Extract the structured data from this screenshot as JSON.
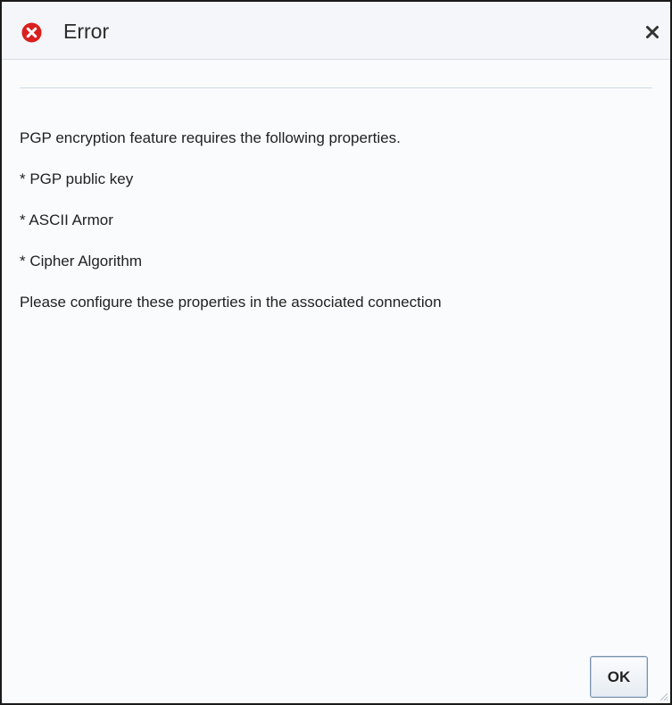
{
  "dialog": {
    "title": "Error",
    "icon": "error-circle-icon",
    "close_icon": "close-icon",
    "message_lines": [
      "PGP encryption feature requires the following properties.",
      "* PGP public key",
      "* ASCII Armor",
      "* Cipher Algorithm",
      "Please configure these properties in the associated connection"
    ],
    "ok_label": "OK"
  },
  "colors": {
    "error_red": "#d9201f",
    "border": "#1a1a1a",
    "background": "#fafbfd"
  }
}
